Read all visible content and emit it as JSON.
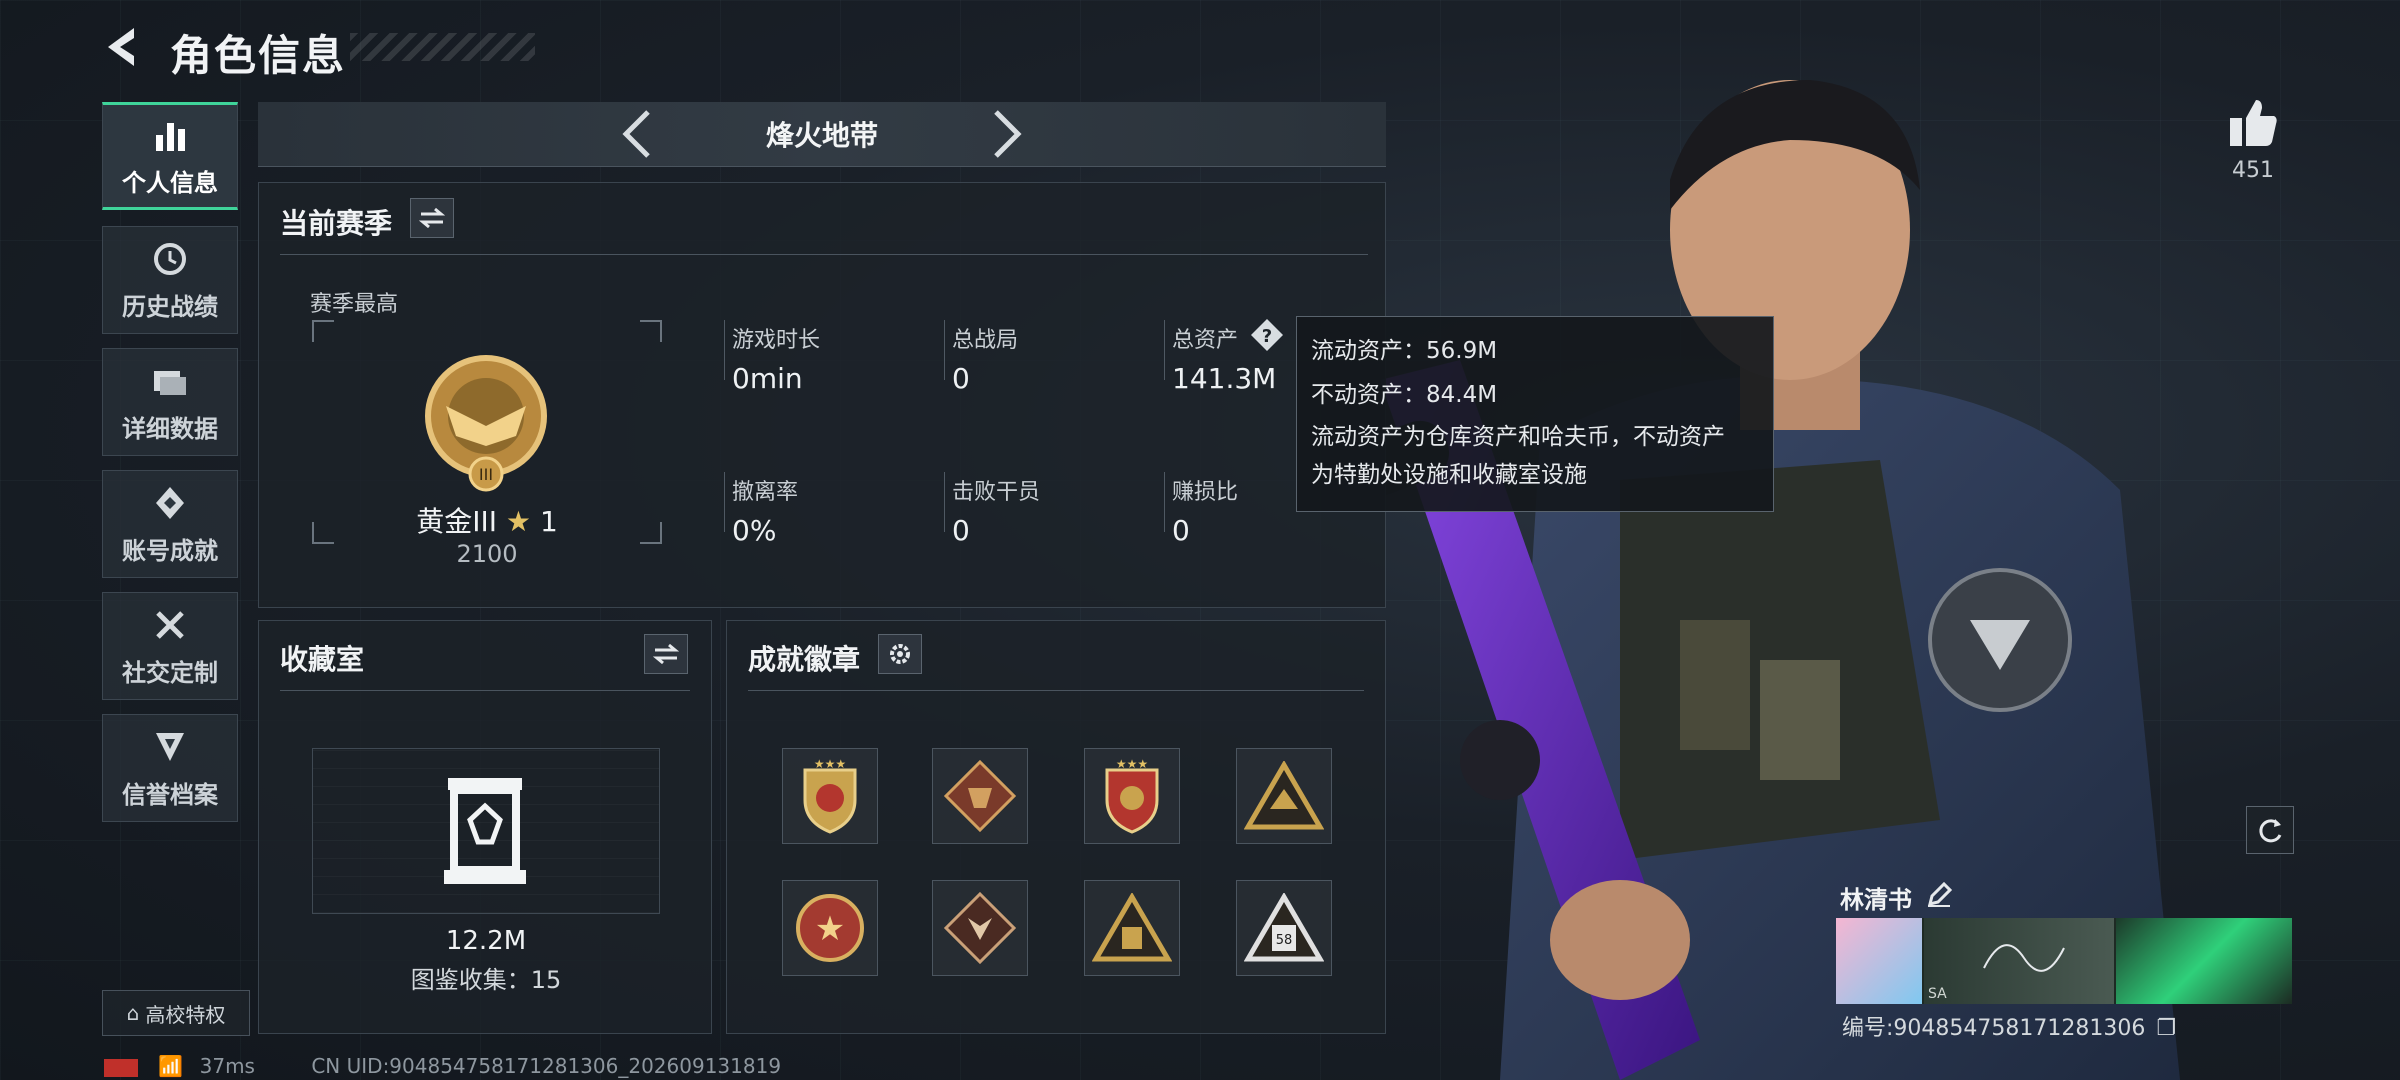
{
  "header": {
    "title": "角色信息"
  },
  "sidebar": {
    "items": [
      {
        "label": "个人信息",
        "icon": "bar-chart-icon",
        "active": true
      },
      {
        "label": "历史战绩",
        "icon": "history-clock-icon",
        "active": false
      },
      {
        "label": "详细数据",
        "icon": "folder-stack-icon",
        "active": false
      },
      {
        "label": "账号成就",
        "icon": "achievement-diamond-icon",
        "active": false
      },
      {
        "label": "社交定制",
        "icon": "tools-cross-icon",
        "active": false
      },
      {
        "label": "信誉档案",
        "icon": "reputation-badge-icon",
        "active": false
      }
    ],
    "campus_label": "高校特权"
  },
  "mode": {
    "label": "烽火地带"
  },
  "season": {
    "title": "当前赛季",
    "best_label": "赛季最高",
    "rank_name": "黄金III",
    "rank_stars": "1",
    "rank_score": "2100",
    "stats": [
      {
        "label": "游戏时长",
        "value": "0min"
      },
      {
        "label": "总战局",
        "value": "0"
      },
      {
        "label": "总资产",
        "value": "141.3M"
      },
      {
        "label": "撤离率",
        "value": "0%"
      },
      {
        "label": "击败干员",
        "value": "0"
      },
      {
        "label": "赚损比",
        "value": "0"
      }
    ]
  },
  "tooltip": {
    "liquid": "流动资产：56.9M",
    "fixed": "不动资产：84.4M",
    "desc_line1": "流动资产为仓库资产和哈夫币，不动资产",
    "desc_line2": "为特勤处设施和收藏室设施"
  },
  "collection": {
    "title": "收藏室",
    "value": "12.2M",
    "collect_text": "图鉴收集：15"
  },
  "badges": {
    "title": "成就徽章",
    "items": [
      "shield-star-badge",
      "dragon-diamond-badge",
      "shield-wing-badge",
      "triangle-gold-badge",
      "star-medal-badge",
      "wolf-diamond-badge",
      "triangle-backpack-badge",
      "triangle-58-badge"
    ],
    "badge_58_text": "58"
  },
  "profile": {
    "likes": "451",
    "name": "林清书",
    "uid_line": "编号:904854758171281306",
    "card_mini_text": "SA"
  },
  "status": {
    "ping": "37ms",
    "cn_uid": "CN UID:904854758171281306_202609131819"
  },
  "colors": {
    "accent": "#3fd49a",
    "weapon_purple": "#6a2cc9",
    "gold": "#c9a34e"
  }
}
